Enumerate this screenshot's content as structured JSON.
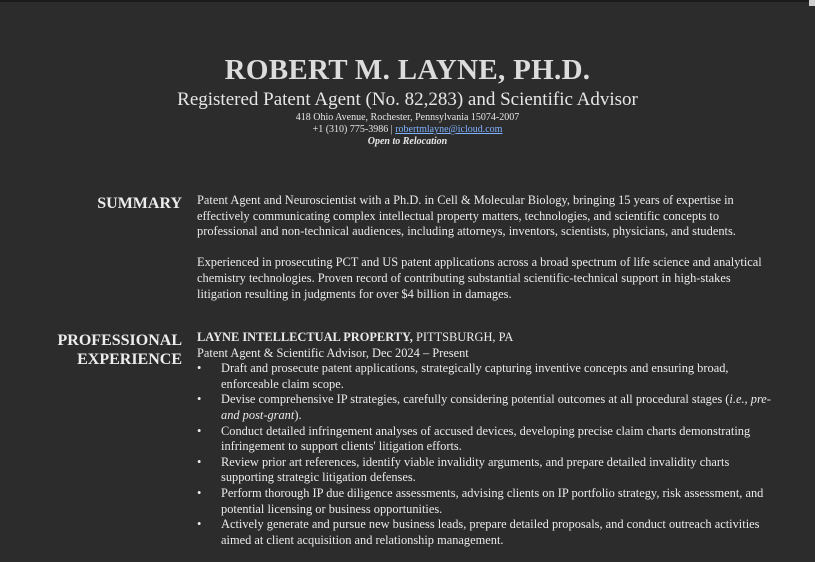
{
  "header": {
    "name": "ROBERT M. LAYNE, PH.D.",
    "title": "Registered Patent Agent (No. 82,283) and Scientific Advisor",
    "address": "418 Ohio Avenue, Rochester, Pennsylvania 15074-2007",
    "phone": "+1 (310) 775-3986 | ",
    "email": "robertmlayne@icloud.com",
    "relocation": "Open to Relocation"
  },
  "summary": {
    "label": "SUMMARY",
    "paragraphs": [
      "Patent Agent and Neuroscientist with a Ph.D. in Cell & Molecular Biology, bringing 15 years of expertise in effectively communicating complex intellectual property matters, technologies, and scientific concepts to professional and non-technical audiences, including attorneys, inventors, scientists, physicians, and students.",
      "Experienced in prosecuting PCT and US patent applications across a broad spectrum of life science and analytical chemistry technologies. Proven record of contributing substantial scientific-technical support in high-stakes litigation resulting in judgments for over $4 billion in damages."
    ]
  },
  "experience": {
    "label_line1": "PROFESSIONAL",
    "label_line2": "EXPERIENCE",
    "company": "LAYNE INTELLECTUAL PROPERTY,",
    "location": " PITTSBURGH, PA",
    "role": "Patent Agent & Scientific Advisor, Dec 2024 – Present",
    "bullet_char": "•",
    "bullets": [
      "Draft and prosecute patent applications, strategically capturing inventive concepts and ensuring broad, enforceable claim scope.",
      "Conduct detailed infringement analyses of accused devices, developing precise claim charts demonstrating infringement to support clients' litigation efforts.",
      "Review prior art references, identify viable invalidity arguments, and prepare detailed invalidity charts supporting strategic litigation defenses.",
      "Perform thorough IP due diligence assessments, advising clients on IP portfolio strategy, risk assessment, and potential licensing or business opportunities.",
      "Actively generate and pursue new business leads, prepare detailed proposals, and conduct outreach activities aimed at client acquisition and relationship management."
    ],
    "bullet2_pre": "Devise comprehensive IP strategies, carefully considering potential outcomes at all procedural stages (",
    "bullet2_em": "i.e., pre- and post-grant",
    "bullet2_post": ")."
  }
}
